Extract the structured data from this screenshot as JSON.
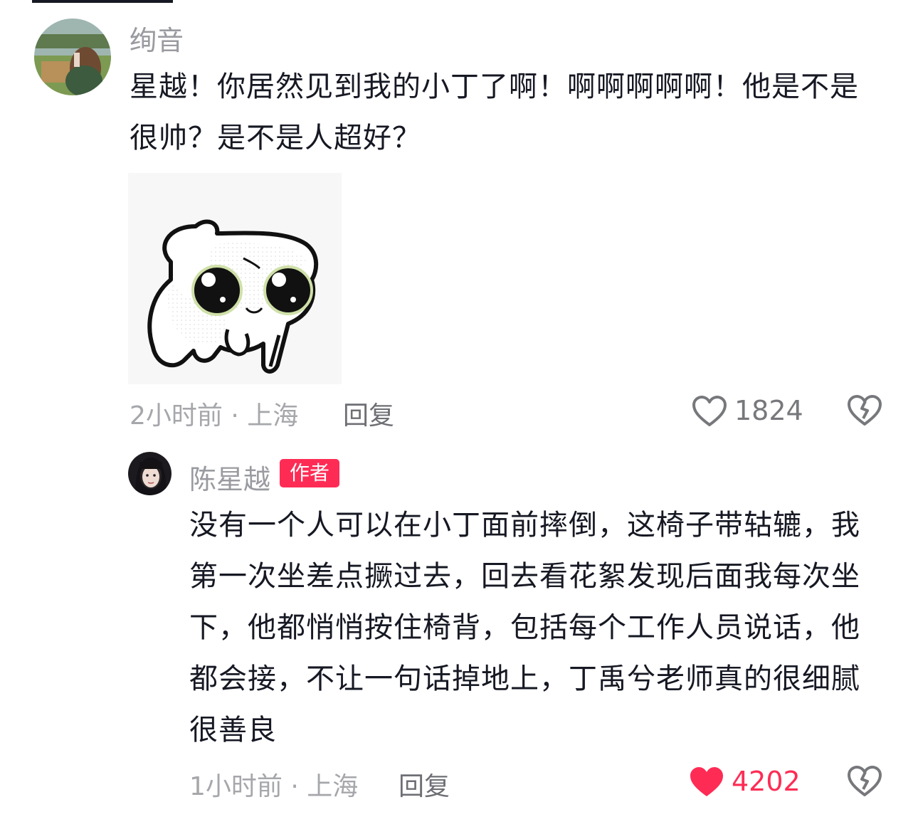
{
  "comments": [
    {
      "username": "绚音",
      "text": "星越！你居然见到我的小丁了啊！啊啊啊啊啊！他是不是很帅？是不是人超好？",
      "has_sticker": true,
      "meta": "2小时前 · 上海",
      "reply_label": "回复",
      "like_count": "1824",
      "liked": false
    },
    {
      "username": "陈星越",
      "badge": "作者",
      "text": "没有一个人可以在小丁面前摔倒，这椅子带轱辘，我第一次坐差点撅过去，回去看花絮发现后面我每次坐下，他都悄悄按住椅背，包括每个工作人员说话，他都会接，不让一句话掉地上，丁禹兮老师真的很细腻很善良",
      "meta": "1小时前 · 上海",
      "reply_label": "回复",
      "like_count": "4202",
      "liked": true
    }
  ],
  "colors": {
    "accent": "#fe2c55",
    "text": "#161823",
    "secondary": "#9a9ba0"
  },
  "icons": {
    "like": "heart-outline-icon",
    "liked": "heart-filled-icon",
    "dislike": "broken-heart-icon"
  }
}
